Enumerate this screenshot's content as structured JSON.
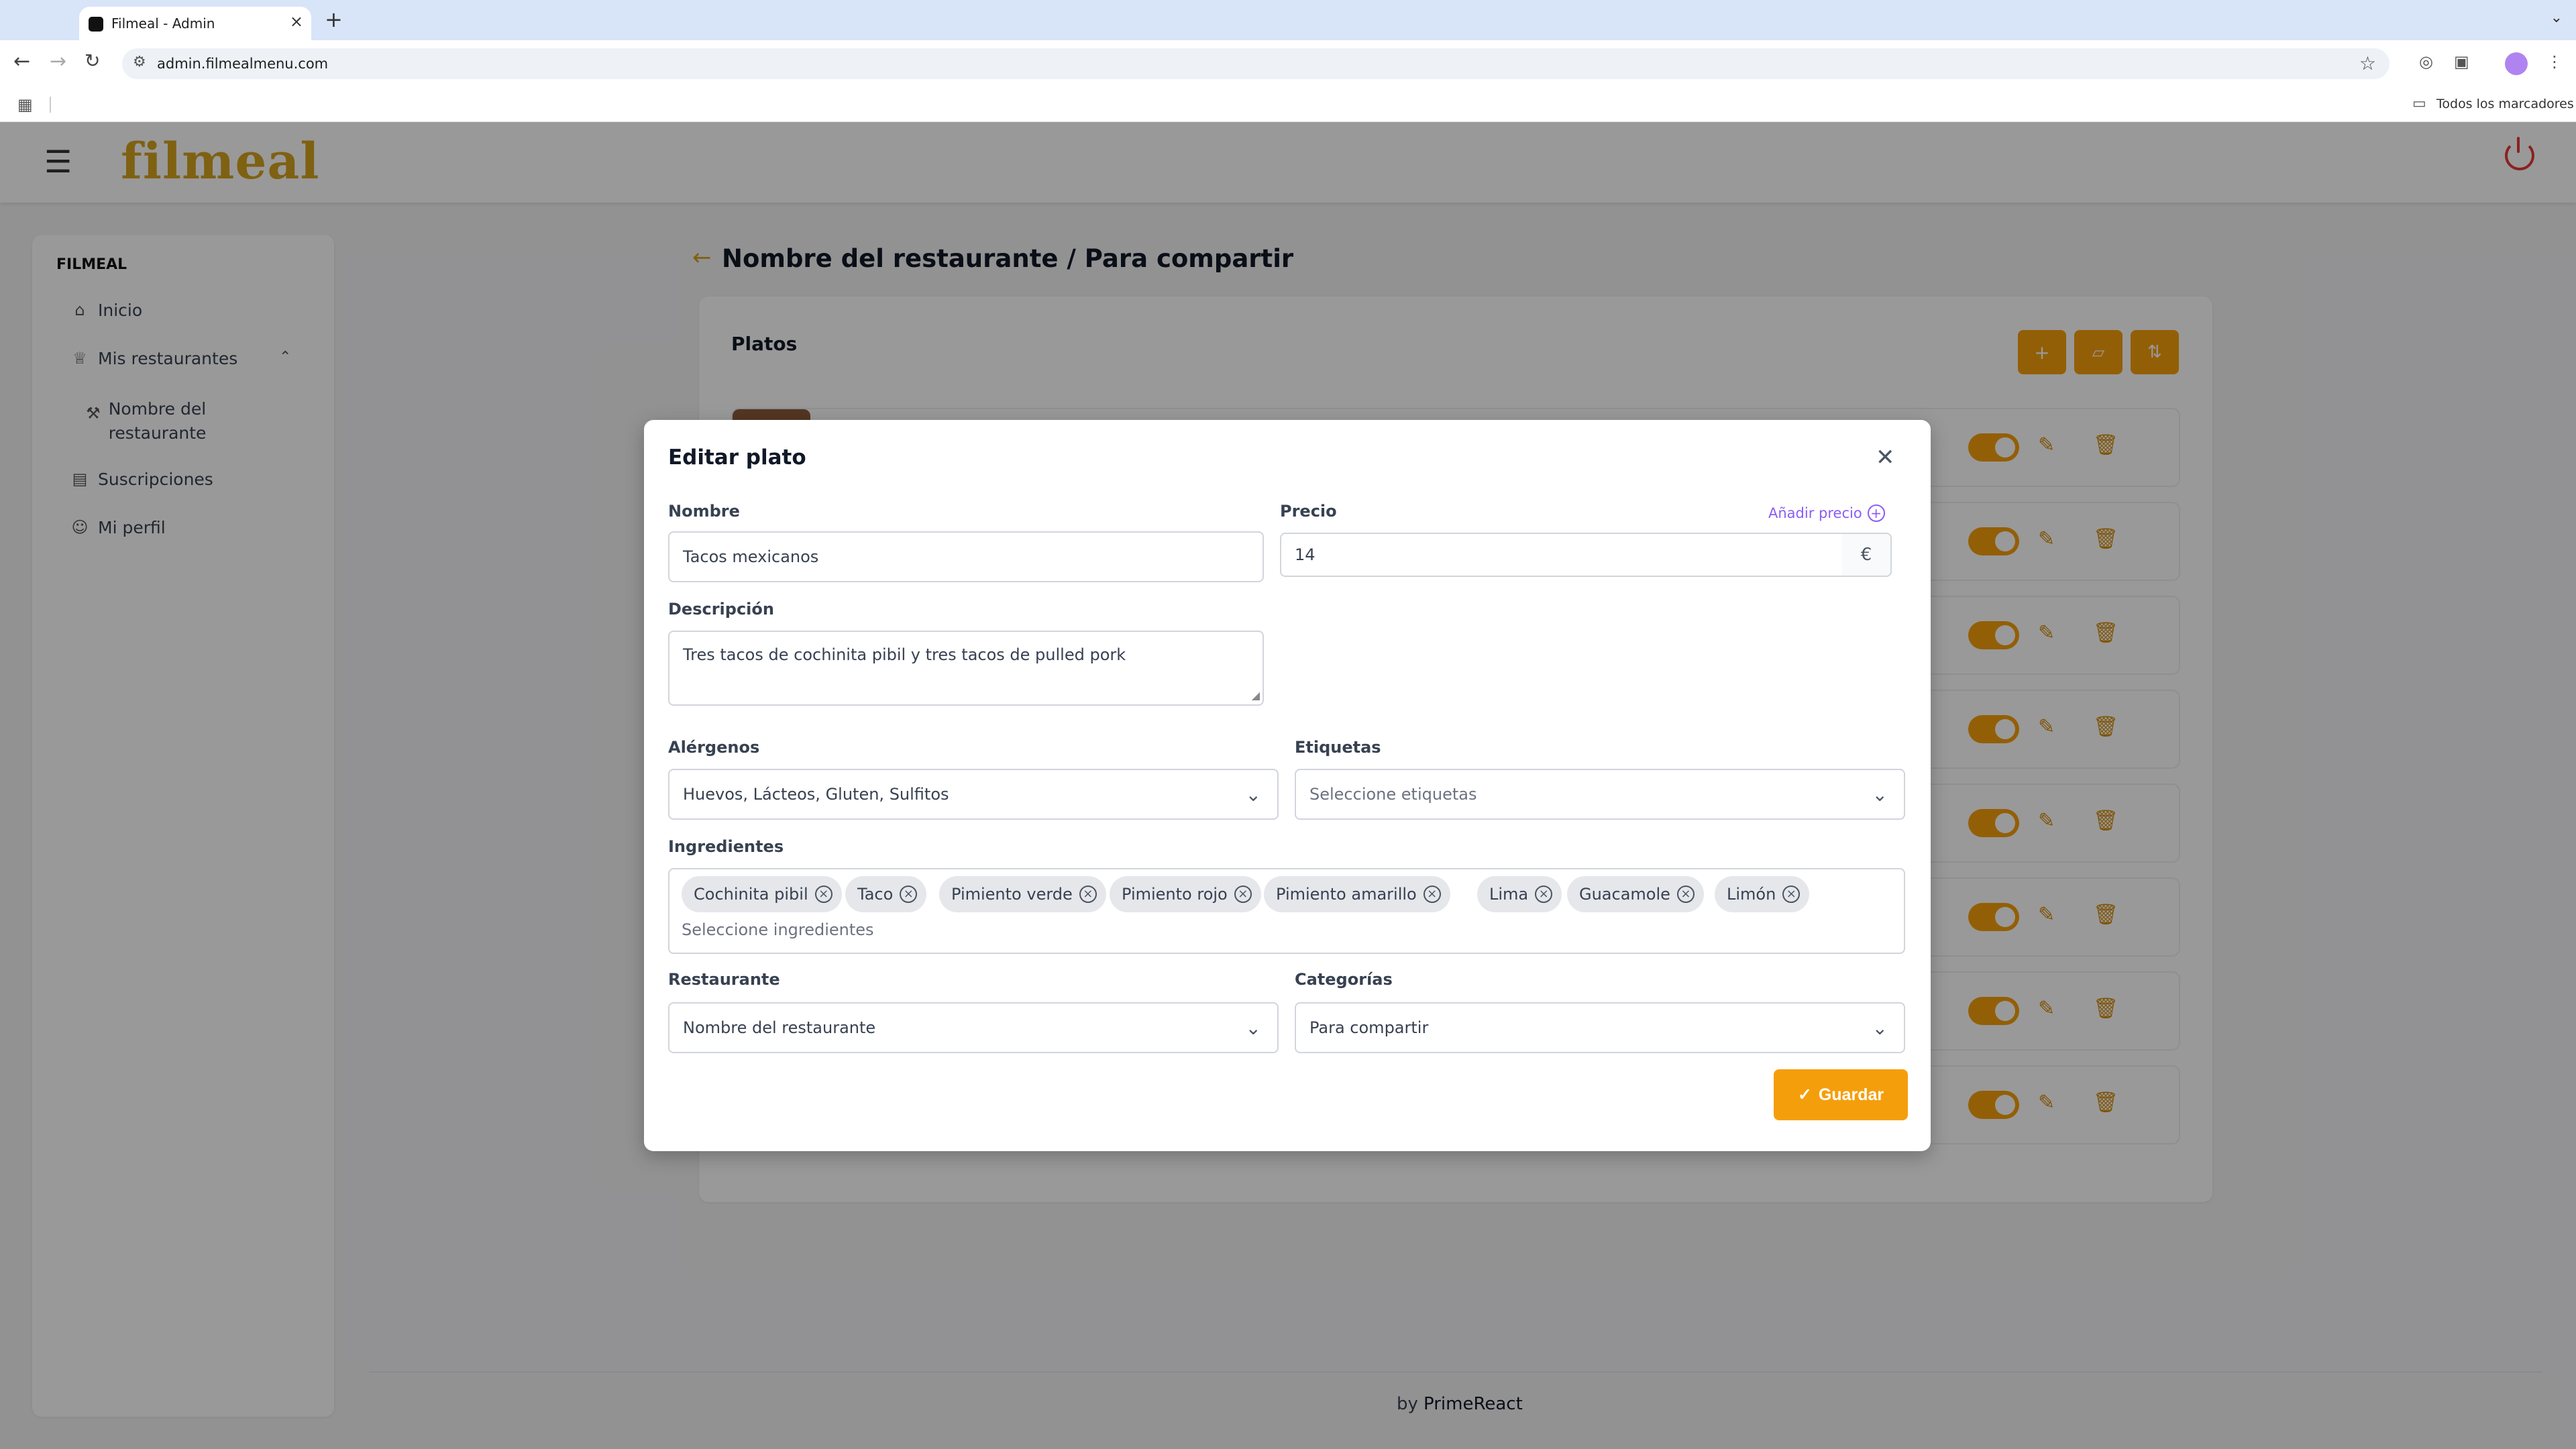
{
  "browser": {
    "tab_title": "Filmeal - Admin",
    "new_tab": "+",
    "url": "admin.filmealmenu.com",
    "bookmarks_all": "Todos los marcadores"
  },
  "app": {
    "logo": "filmeal",
    "sidebar": {
      "section": "FILMEAL",
      "items": [
        {
          "label": "Inicio",
          "icon": "home-icon"
        },
        {
          "label": "Mis restaurantes",
          "icon": "trophy-icon"
        },
        {
          "label": "Nombre del restaurante",
          "icon": "wrench-icon"
        },
        {
          "label": "Suscripciones",
          "icon": "document-icon"
        },
        {
          "label": "Mi perfil",
          "icon": "user-icon"
        }
      ]
    },
    "page_title": "Nombre del restaurante / Para compartir",
    "card_title": "Platos",
    "footer": {
      "by": "by",
      "brand": "PrimeReact"
    }
  },
  "modal": {
    "title": "Editar plato",
    "nombre_label": "Nombre",
    "nombre_value": "Tacos mexicanos",
    "precio_label": "Precio",
    "precio_value": "14",
    "precio_currency": "€",
    "add_price": "Añadir precio",
    "descripcion_label": "Descripción",
    "descripcion_value": "Tres tacos de cochinita pibil y tres tacos de pulled pork",
    "alergenos_label": "Alérgenos",
    "alergenos_value": "Huevos, Lácteos, Gluten, Sulfitos",
    "etiquetas_label": "Etiquetas",
    "etiquetas_placeholder": "Seleccione etiquetas",
    "ingredientes_label": "Ingredientes",
    "ingredientes": [
      "Cochinita pibil",
      "Taco",
      "Pimiento verde",
      "Pimiento rojo",
      "Pimiento amarillo",
      "Lima",
      "Guacamole",
      "Limón"
    ],
    "ingredientes_placeholder": "Seleccione ingredientes",
    "restaurante_label": "Restaurante",
    "restaurante_value": "Nombre del restaurante",
    "categorias_label": "Categorías",
    "categorias_value": "Para compartir",
    "save_label": "Guardar"
  },
  "colors": {
    "accent": "#f59e0b",
    "logo": "#d4a21f",
    "link": "#8b5cf6",
    "power": "#e53935"
  }
}
